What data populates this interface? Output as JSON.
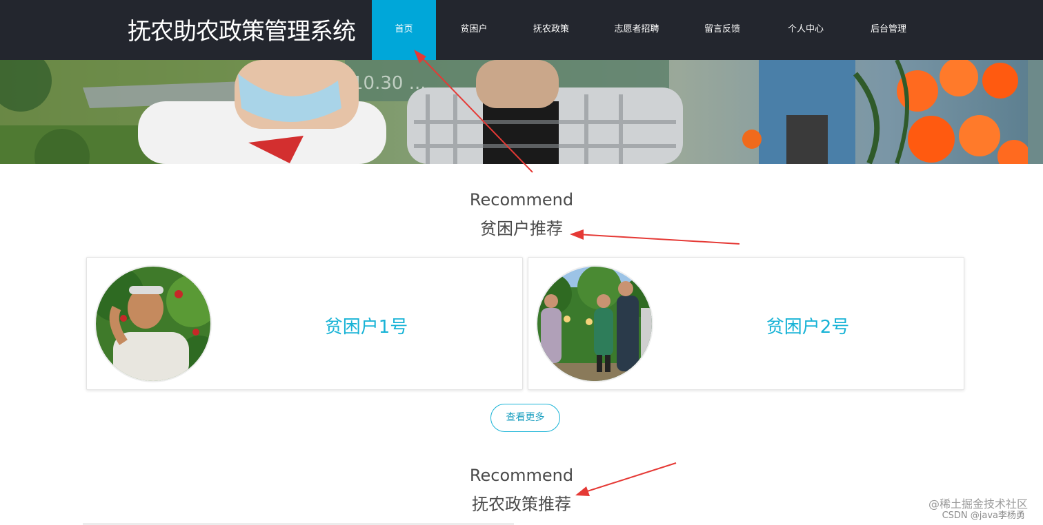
{
  "header": {
    "site_title": "抚农助农政策管理系统",
    "nav": [
      {
        "label": "首页",
        "active": true
      },
      {
        "label": "贫困户",
        "active": false
      },
      {
        "label": "抚农政策",
        "active": false
      },
      {
        "label": "志愿者招聘",
        "active": false
      },
      {
        "label": "留言反馈",
        "active": false
      },
      {
        "label": "个人中心",
        "active": false
      },
      {
        "label": "后台管理",
        "active": false
      }
    ]
  },
  "section_poor": {
    "subtitle_en": "Recommend",
    "title": "贫困户推荐",
    "cards": [
      {
        "name": "贫困户1号"
      },
      {
        "name": "贫困户2号"
      }
    ],
    "more_label": "查看更多"
  },
  "section_policy": {
    "subtitle_en": "Recommend",
    "title": "抚农政策推荐"
  },
  "watermark": {
    "line1": "@稀土掘金技术社区",
    "line2": "CSDN @java李杨勇"
  },
  "colors": {
    "nav_bg": "#23262e",
    "accent": "#00a7d9",
    "link": "#18b3d6",
    "annotation_arrow": "#e53935"
  }
}
